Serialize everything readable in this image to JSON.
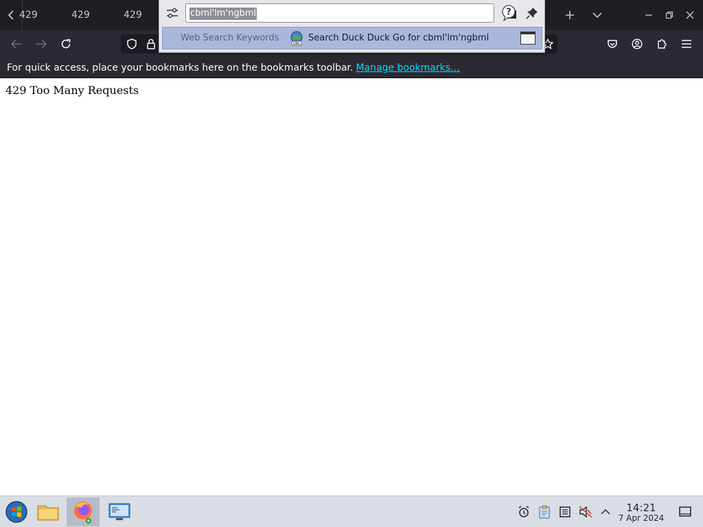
{
  "tabs": [
    {
      "label": "429"
    },
    {
      "label": "429"
    },
    {
      "label": "429"
    }
  ],
  "bookmarks_bar": {
    "message": "For quick access, place your bookmarks here on the bookmarks toolbar.",
    "link": "Manage bookmarks…"
  },
  "page": {
    "error_text": "429 Too Many Requests"
  },
  "search_popup": {
    "input_value": "cbml'lm'ngbml",
    "result": {
      "keyword_label": "Web Search Keywords",
      "search_text": "Search Duck Duck Go for cbml'lm'ngbml"
    }
  },
  "taskbar": {
    "time": "14:21",
    "date": "7 Apr 2024"
  },
  "colors": {
    "tabstrip_bg": "#1f1e25",
    "toolbar_bg": "#2b2a33",
    "link": "#00ddff",
    "popup_row_highlight": "#a9b7dc",
    "taskbar_bg": "#d9dde4"
  }
}
